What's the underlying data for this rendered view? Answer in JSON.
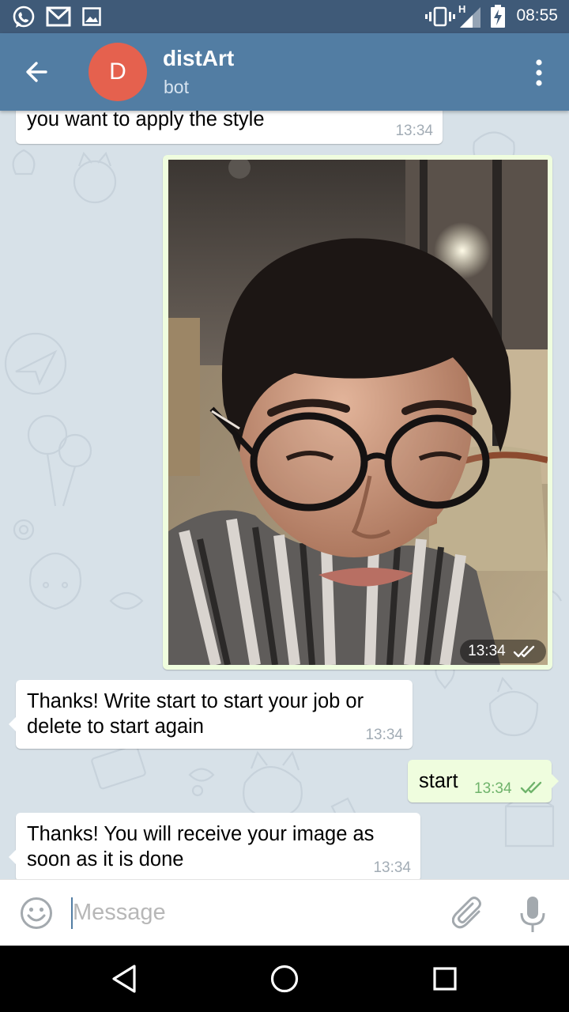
{
  "status_bar": {
    "time": "08:55",
    "left_icons": [
      "whatsapp-icon",
      "gmail-icon",
      "gallery-icon"
    ],
    "right_icons": [
      "vibrate-icon",
      "signal-icon",
      "battery-charging-icon"
    ],
    "network_label": "H"
  },
  "header": {
    "avatar_letter": "D",
    "avatar_color": "#e5614e",
    "title": "distArt",
    "subtitle": "bot",
    "back_icon": "arrow-left-icon",
    "menu_icon": "more-vert-icon",
    "bar_color": "#527da3"
  },
  "messages": [
    {
      "direction": "in",
      "text": "you want to apply the style",
      "time": "13:34"
    },
    {
      "direction": "out",
      "type": "photo",
      "photo_alt": "selfie of a man with glasses and a scarf",
      "time": "13:34",
      "status_icon": "double-check-icon"
    },
    {
      "direction": "in",
      "text": "Thanks! Write start to start your job or\ndelete to start again",
      "time": "13:34"
    },
    {
      "direction": "out",
      "text": "start",
      "time": "13:34",
      "status_icon": "double-check-icon"
    },
    {
      "direction": "in",
      "text": "Thanks! You will receive your image as\nsoon as it is done",
      "time": "13:34"
    }
  ],
  "composer": {
    "placeholder": "Message",
    "value": "",
    "emoji_icon": "emoji-icon",
    "attach_icon": "paperclip-icon",
    "mic_icon": "mic-icon"
  },
  "nav_bar": {
    "buttons": [
      "back-triangle-icon",
      "home-circle-icon",
      "recents-square-icon"
    ]
  }
}
